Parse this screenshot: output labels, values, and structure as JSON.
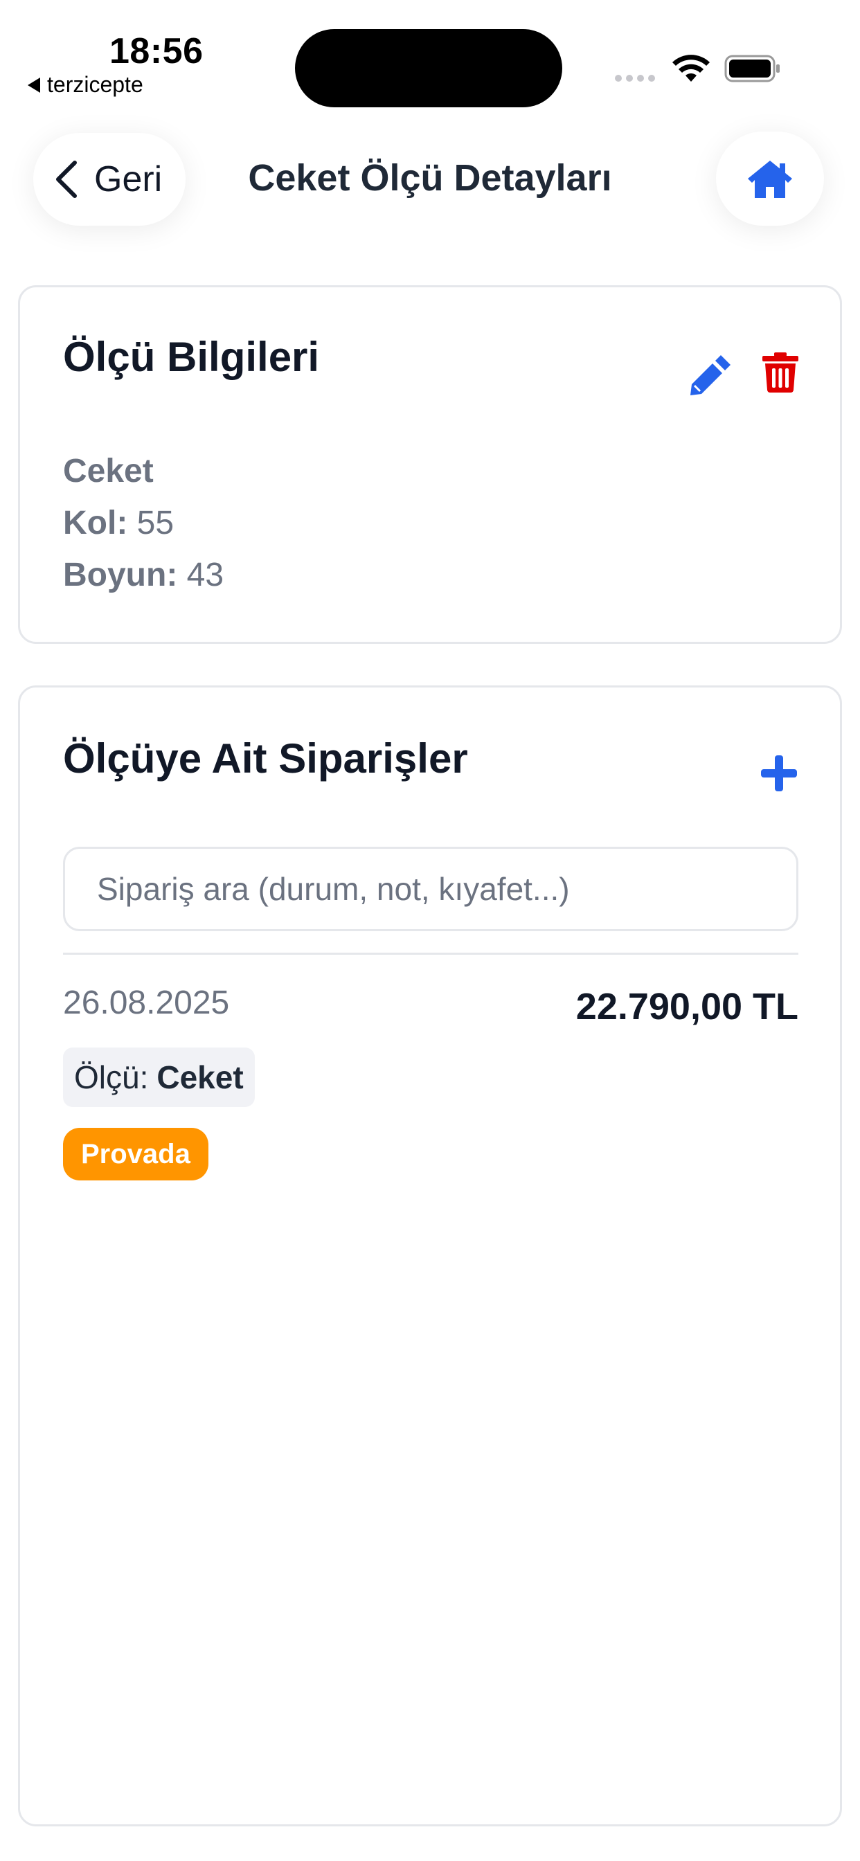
{
  "status_bar": {
    "time": "18:56",
    "back_app": "terzicepte"
  },
  "nav": {
    "back_label": "Geri",
    "title": "Ceket Ölçü Detayları"
  },
  "measurement_card": {
    "title": "Ölçü Bilgileri",
    "type": "Ceket",
    "fields": [
      {
        "label": "Kol:",
        "value": "55"
      },
      {
        "label": "Boyun:",
        "value": "43"
      }
    ]
  },
  "orders_card": {
    "title": "Ölçüye Ait Siparişler",
    "search_placeholder": "Sipariş ara (durum, not, kıyafet...)",
    "orders": [
      {
        "date": "26.08.2025",
        "amount": "22.790,00 TL",
        "measure_label": "Ölçü:",
        "measure_value": "Ceket",
        "status": "Provada"
      }
    ]
  },
  "colors": {
    "accent": "#2563eb",
    "danger": "#e00000",
    "status_provada": "#ff9500"
  },
  "icons": {
    "back": "chevron-left-icon",
    "home": "home-icon",
    "edit": "pencil-icon",
    "delete": "trash-icon",
    "add": "plus-icon"
  }
}
